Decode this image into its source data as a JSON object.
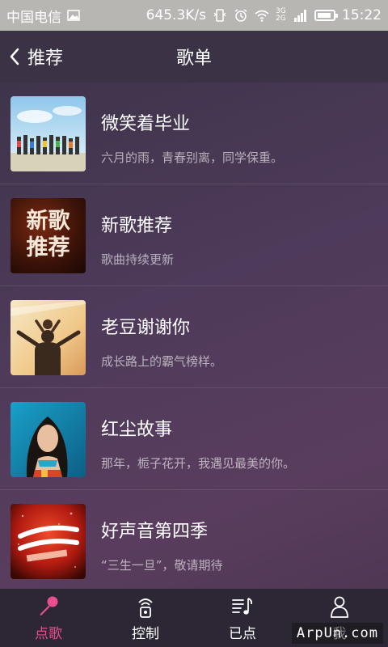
{
  "status_bar": {
    "carrier": "中国电信",
    "speed": "645.3K/s",
    "network": "3G 2G",
    "time": "15:22"
  },
  "header": {
    "back_label": "推荐",
    "title": "歌单"
  },
  "playlists": [
    {
      "title": "微笑着毕业",
      "subtitle": "六月的雨，青春别离，同学保重。"
    },
    {
      "title": "新歌推荐",
      "subtitle": "歌曲持续更新",
      "cover_text": "新歌推荐"
    },
    {
      "title": "老豆谢谢你",
      "subtitle": "成长路上的霸气榜样。"
    },
    {
      "title": "红尘故事",
      "subtitle": "那年，栀子花开，我遇见最美的你。"
    },
    {
      "title": "好声音第四季",
      "subtitle": "“三生一旦”，敬请期待"
    }
  ],
  "tabs": [
    {
      "label": "点歌",
      "icon": "microphone-icon",
      "active": true
    },
    {
      "label": "控制",
      "icon": "remote-icon",
      "active": false
    },
    {
      "label": "已点",
      "icon": "music-list-icon",
      "active": false
    },
    {
      "label": "我",
      "icon": "person-icon",
      "active": false
    }
  ],
  "watermark": "ArpUn.com",
  "colors": {
    "accent": "#e84f8c",
    "header": "#3b3345",
    "tabbar": "#2d2735"
  }
}
